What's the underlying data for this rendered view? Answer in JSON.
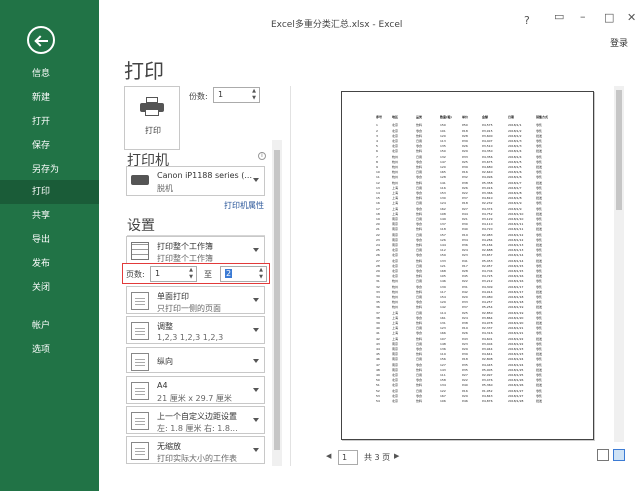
{
  "window": {
    "title": "Excel多重分类汇总.xlsx - Excel",
    "help": "?",
    "login": "登录"
  },
  "nav": {
    "items": [
      {
        "label": "信息",
        "active": false
      },
      {
        "label": "新建",
        "active": false
      },
      {
        "label": "打开",
        "active": false
      },
      {
        "label": "保存",
        "active": false
      },
      {
        "label": "另存为",
        "active": false
      },
      {
        "label": "打印",
        "active": true
      },
      {
        "label": "共享",
        "active": false
      },
      {
        "label": "导出",
        "active": false
      },
      {
        "label": "发布",
        "active": false
      },
      {
        "label": "关闭",
        "active": false
      },
      {
        "label": "帐户",
        "active": false
      },
      {
        "label": "选项",
        "active": false
      }
    ]
  },
  "print": {
    "heading": "打印",
    "button_label": "打印",
    "copies_label": "份数:",
    "copies_value": "1",
    "printer_section": "打印机",
    "printer_name": "Canon iP1188 series (...",
    "printer_status": "脱机",
    "printer_properties": "打印机属性",
    "settings_section": "设置",
    "scope_l1": "打印整个工作簿",
    "scope_l2": "打印整个工作簿",
    "pages_label": "页数:",
    "pages_from": "1",
    "pages_to_label": "至",
    "pages_to": "2",
    "sided_l1": "单面打印",
    "sided_l2": "只打印一侧的页面",
    "collate_l1": "调整",
    "collate_l2": "1,2,3    1,2,3    1,2,3",
    "orientation": "纵向",
    "paper_l1": "A4",
    "paper_l2": "21 厘米 x 29.7 厘米",
    "margins_l1": "上一个自定义边距设置",
    "margins_l2": "左: 1.8 厘米    右: 1.8...",
    "scaling_l1": "无缩放",
    "scaling_l2": "打印实际大小的工作表"
  },
  "pager": {
    "current": "1",
    "total": "共 3 页"
  },
  "preview": {
    "headers": [
      "序号",
      "地区",
      "品类",
      "数量(箱)",
      "单价",
      "金额",
      "日期",
      "销售方式"
    ],
    "rows": [
      [
        "1",
        "北京",
        "饮料",
        "150",
        "¥50",
        "¥4,575",
        "2018/1/1",
        "零售"
      ],
      [
        "2",
        "北京",
        "零食",
        "101",
        "¥18",
        "¥3,915",
        "2018/1/2",
        "零售"
      ],
      [
        "3",
        "北京",
        "饮料",
        "120",
        "¥28",
        "¥3,600",
        "2018/1/2",
        "批发"
      ],
      [
        "4",
        "北京",
        "日用",
        "113",
        "¥39",
        "¥4,407",
        "2018/1/3",
        "零售"
      ],
      [
        "5",
        "北京",
        "零食",
        "135",
        "¥26",
        "¥3,510",
        "2018/1/3",
        "零售"
      ],
      [
        "6",
        "北京",
        "饮料",
        "150",
        "¥29",
        "¥4,350",
        "2018/1/4",
        "批发"
      ],
      [
        "7",
        "杭州",
        "日用",
        "132",
        "¥33",
        "¥4,356",
        "2018/1/4",
        "零售"
      ],
      [
        "8",
        "杭州",
        "零食",
        "147",
        "¥25",
        "¥3,675",
        "2018/1/5",
        "零售"
      ],
      [
        "9",
        "杭州",
        "饮料",
        "120",
        "¥39",
        "¥4,680",
        "2018/1/5",
        "批发"
      ],
      [
        "10",
        "杭州",
        "日用",
        "165",
        "¥16",
        "¥2,640",
        "2018/1/6",
        "零售"
      ],
      [
        "11",
        "杭州",
        "零食",
        "128",
        "¥32",
        "¥4,096",
        "2018/1/6",
        "零售"
      ],
      [
        "12",
        "杭州",
        "饮料",
        "141",
        "¥38",
        "¥5,358",
        "2018/1/7",
        "批发"
      ],
      [
        "13",
        "上海",
        "日用",
        "116",
        "¥26",
        "¥3,016",
        "2018/1/7",
        "零售"
      ],
      [
        "14",
        "上海",
        "零食",
        "153",
        "¥22",
        "¥3,366",
        "2018/1/8",
        "零售"
      ],
      [
        "15",
        "上海",
        "饮料",
        "130",
        "¥37",
        "¥4,810",
        "2018/1/8",
        "批发"
      ],
      [
        "16",
        "上海",
        "日用",
        "124",
        "¥18",
        "¥2,232",
        "2018/1/9",
        "零售"
      ],
      [
        "17",
        "上海",
        "零食",
        "162",
        "¥27",
        "¥4,374",
        "2018/1/9",
        "零售"
      ],
      [
        "18",
        "上海",
        "饮料",
        "108",
        "¥44",
        "¥4,752",
        "2018/1/10",
        "批发"
      ],
      [
        "19",
        "南京",
        "日用",
        "149",
        "¥21",
        "¥3,129",
        "2018/1/10",
        "零售"
      ],
      [
        "20",
        "南京",
        "零食",
        "137",
        "¥30",
        "¥4,110",
        "2018/1/11",
        "零售"
      ],
      [
        "21",
        "南京",
        "饮料",
        "118",
        "¥40",
        "¥4,720",
        "2018/1/11",
        "批发"
      ],
      [
        "22",
        "南京",
        "日用",
        "157",
        "¥19",
        "¥2,983",
        "2018/1/12",
        "零售"
      ],
      [
        "23",
        "南京",
        "零食",
        "126",
        "¥34",
        "¥4,284",
        "2018/1/12",
        "零售"
      ],
      [
        "24",
        "南京",
        "饮料",
        "144",
        "¥36",
        "¥5,184",
        "2018/1/13",
        "批发"
      ],
      [
        "25",
        "北京",
        "日用",
        "112",
        "¥24",
        "¥2,688",
        "2018/1/13",
        "零售"
      ],
      [
        "26",
        "北京",
        "零食",
        "159",
        "¥23",
        "¥3,657",
        "2018/1/14",
        "零售"
      ],
      [
        "27",
        "北京",
        "饮料",
        "133",
        "¥41",
        "¥5,453",
        "2018/1/14",
        "批发"
      ],
      [
        "28",
        "北京",
        "日用",
        "121",
        "¥17",
        "¥2,057",
        "2018/1/15",
        "零售"
      ],
      [
        "29",
        "北京",
        "零食",
        "168",
        "¥28",
        "¥4,704",
        "2018/1/15",
        "零售"
      ],
      [
        "30",
        "北京",
        "饮料",
        "105",
        "¥45",
        "¥4,725",
        "2018/1/16",
        "批发"
      ],
      [
        "31",
        "杭州",
        "日用",
        "146",
        "¥22",
        "¥3,212",
        "2018/1/16",
        "零售"
      ],
      [
        "32",
        "杭州",
        "零食",
        "139",
        "¥31",
        "¥4,309",
        "2018/1/17",
        "零售"
      ],
      [
        "33",
        "杭州",
        "饮料",
        "117",
        "¥42",
        "¥4,914",
        "2018/1/17",
        "批发"
      ],
      [
        "34",
        "杭州",
        "日用",
        "154",
        "¥20",
        "¥3,080",
        "2018/1/18",
        "零售"
      ],
      [
        "35",
        "杭州",
        "零食",
        "129",
        "¥33",
        "¥4,257",
        "2018/1/18",
        "零售"
      ],
      [
        "36",
        "杭州",
        "饮料",
        "142",
        "¥37",
        "¥5,254",
        "2018/1/19",
        "批发"
      ],
      [
        "37",
        "上海",
        "日用",
        "114",
        "¥25",
        "¥2,850",
        "2018/1/19",
        "零售"
      ],
      [
        "38",
        "上海",
        "零食",
        "161",
        "¥24",
        "¥3,864",
        "2018/1/20",
        "零售"
      ],
      [
        "39",
        "上海",
        "饮料",
        "131",
        "¥38",
        "¥4,978",
        "2018/1/20",
        "批发"
      ],
      [
        "40",
        "上海",
        "日用",
        "123",
        "¥19",
        "¥2,337",
        "2018/1/21",
        "零售"
      ],
      [
        "41",
        "上海",
        "零食",
        "166",
        "¥26",
        "¥4,316",
        "2018/1/21",
        "零售"
      ],
      [
        "42",
        "上海",
        "饮料",
        "107",
        "¥43",
        "¥4,601",
        "2018/1/22",
        "批发"
      ],
      [
        "43",
        "南京",
        "日用",
        "148",
        "¥23",
        "¥3,404",
        "2018/1/22",
        "零售"
      ],
      [
        "44",
        "南京",
        "零食",
        "136",
        "¥29",
        "¥3,944",
        "2018/1/23",
        "零售"
      ],
      [
        "45",
        "南京",
        "饮料",
        "119",
        "¥39",
        "¥4,641",
        "2018/1/23",
        "批发"
      ],
      [
        "46",
        "南京",
        "日用",
        "156",
        "¥18",
        "¥2,808",
        "2018/1/24",
        "零售"
      ],
      [
        "47",
        "南京",
        "零食",
        "127",
        "¥35",
        "¥4,445",
        "2018/1/24",
        "零售"
      ],
      [
        "48",
        "南京",
        "饮料",
        "143",
        "¥35",
        "¥5,005",
        "2018/1/25",
        "批发"
      ],
      [
        "49",
        "北京",
        "日用",
        "111",
        "¥27",
        "¥2,997",
        "2018/1/25",
        "零售"
      ],
      [
        "50",
        "北京",
        "零食",
        "158",
        "¥22",
        "¥3,476",
        "2018/1/26",
        "零售"
      ],
      [
        "51",
        "北京",
        "饮料",
        "134",
        "¥40",
        "¥5,360",
        "2018/1/26",
        "批发"
      ],
      [
        "52",
        "北京",
        "日用",
        "122",
        "¥16",
        "¥1,952",
        "2018/1/27",
        "零售"
      ],
      [
        "53",
        "北京",
        "零食",
        "167",
        "¥29",
        "¥4,843",
        "2018/1/27",
        "零售"
      ],
      [
        "54",
        "北京",
        "饮料",
        "106",
        "¥46",
        "¥4,876",
        "2018/1/28",
        "批发"
      ]
    ]
  }
}
